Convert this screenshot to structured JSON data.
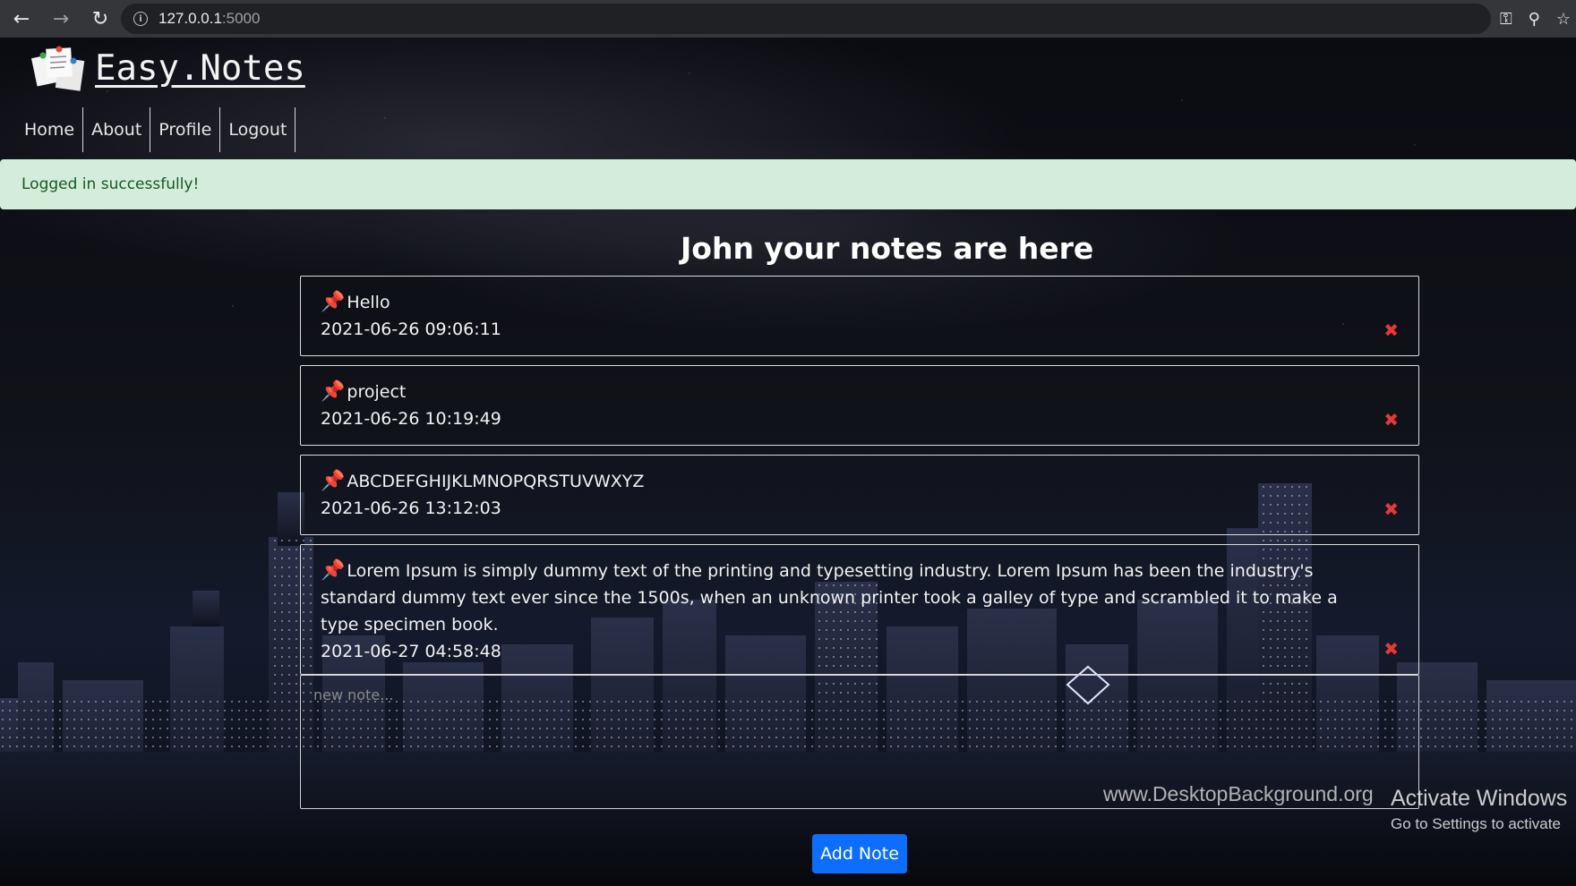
{
  "browser": {
    "url_host": "127.0.0.1",
    "url_port": ":5000"
  },
  "brand": {
    "name": "Easy.Notes"
  },
  "nav": {
    "items": [
      "Home",
      "About",
      "Profile",
      "Logout"
    ]
  },
  "flash": {
    "message": "Logged in successfully!"
  },
  "heading": "John your notes are here",
  "notes": [
    {
      "text": "Hello",
      "date": "2021-06-26 09:06:11"
    },
    {
      "text": "project",
      "date": "2021-06-26 10:19:49"
    },
    {
      "text": "ABCDEFGHIJKLMNOPQRSTUVWXYZ",
      "date": "2021-06-26 13:12:03"
    },
    {
      "text": "Lorem Ipsum is simply dummy text of the printing and typesetting industry. Lorem Ipsum has been the industry's standard dummy text ever since the 1500s, when an unknown printer took a galley of type and scrambled it to make a type specimen book.",
      "date": "2021-06-27 04:58:48"
    }
  ],
  "new_note": {
    "placeholder": "new note..."
  },
  "add_button": "Add Note",
  "watermark": "www.DesktopBackground.org",
  "windows_notice": {
    "title": "Activate Windows",
    "subtitle": "Go to Settings to activate"
  },
  "colors": {
    "flash_bg": "#d4edda",
    "flash_text": "#155724",
    "button": "#0d6efd",
    "delete": "#e53935"
  }
}
